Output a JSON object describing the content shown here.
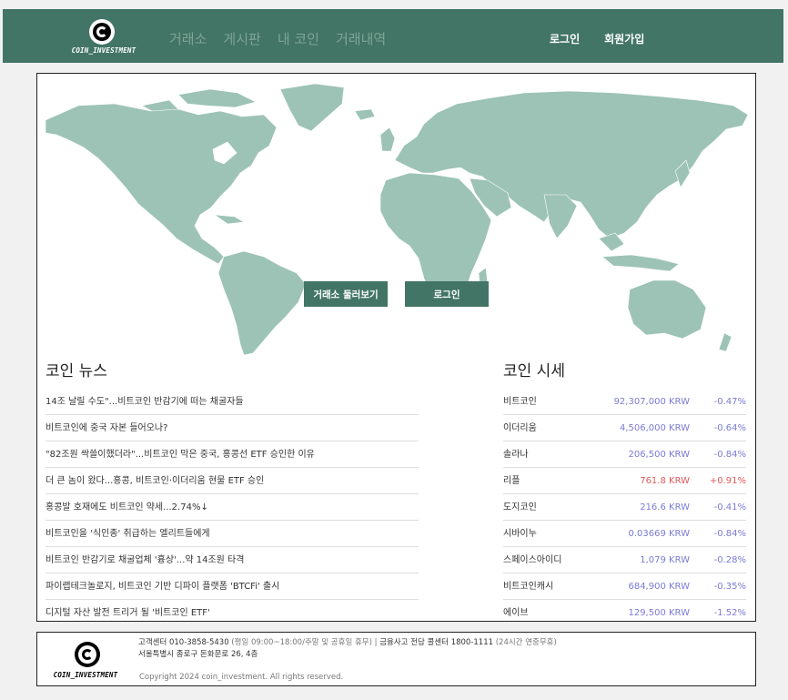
{
  "header": {
    "logo_text": "COIN_INVESTMENT",
    "nav": [
      "거래소",
      "게시판",
      "내 코인",
      "거래내역"
    ],
    "login": "로그인",
    "signup": "회원가입"
  },
  "hero": {
    "browse_button": "거래소 둘러보기",
    "login_button": "로그인"
  },
  "news": {
    "title": "코인 뉴스",
    "items": [
      "14조 날릴 수도\"...비트코인 반감기에 떠는 채굴자들",
      "비트코인에 중국 자본 들어오나?",
      "\"82조원 싹쓸이했더라\"...비트코인 막은 중국, 홍콩선 ETF 승인한 이유",
      "더 큰 놈이 왔다...홍콩, 비트코인·이더리움 현물 ETF 승인",
      "홍콩발 호재에도 비트코인 약세...2.74%↓",
      "비트코인을 '식인종' 취급하는 엘리트들에게",
      "비트코인 반감기로 채굴업체 '흉상'...약 14조원 타격",
      "파이랩테크놀로지, 비트코인 기반 디파이 플랫폼 'BTCFi' 출시",
      "디지털 자산 발전 트리거 될 '비트코인 ETF'"
    ]
  },
  "prices": {
    "title": "코인 시세",
    "rows": [
      {
        "name": "비트코인",
        "price": "92,307,000 KRW",
        "change": "-0.47%"
      },
      {
        "name": "이더리움",
        "price": "4,506,000 KRW",
        "change": "-0.64%"
      },
      {
        "name": "솔라나",
        "price": "206,500 KRW",
        "change": "-0.84%"
      },
      {
        "name": "리플",
        "price": "761.8 KRW",
        "change": "+0.91%"
      },
      {
        "name": "도지코인",
        "price": "216.6 KRW",
        "change": "-0.41%"
      },
      {
        "name": "시바이누",
        "price": "0.03669 KRW",
        "change": "-0.84%"
      },
      {
        "name": "스페이스아이디",
        "price": "1,079 KRW",
        "change": "-0.28%"
      },
      {
        "name": "비트코인캐시",
        "price": "684,900 KRW",
        "change": "-0.35%"
      },
      {
        "name": "에이브",
        "price": "129,500 KRW",
        "change": "-1.52%"
      }
    ]
  },
  "footer": {
    "logo_text": "COIN_INVESTMENT",
    "line1_a": "고객센터 010-3858-5430",
    "line1_b": " (평일 09:00~18:00/주말 및 공휴일 휴무) | ",
    "line1_c": "금융사고 전담 콜센터 1800-1111",
    "line1_d": " (24시간 연중무휴)",
    "line2": "서울특별시 종로구 돈화문로 26, 4층",
    "copyright": "Copyright 2024 coin_investment. All rights reserved."
  },
  "colors": {
    "brand": "#427565",
    "map": "#9dc3b6",
    "negative": "#7b7bd6",
    "positive": "#e05a5a"
  }
}
